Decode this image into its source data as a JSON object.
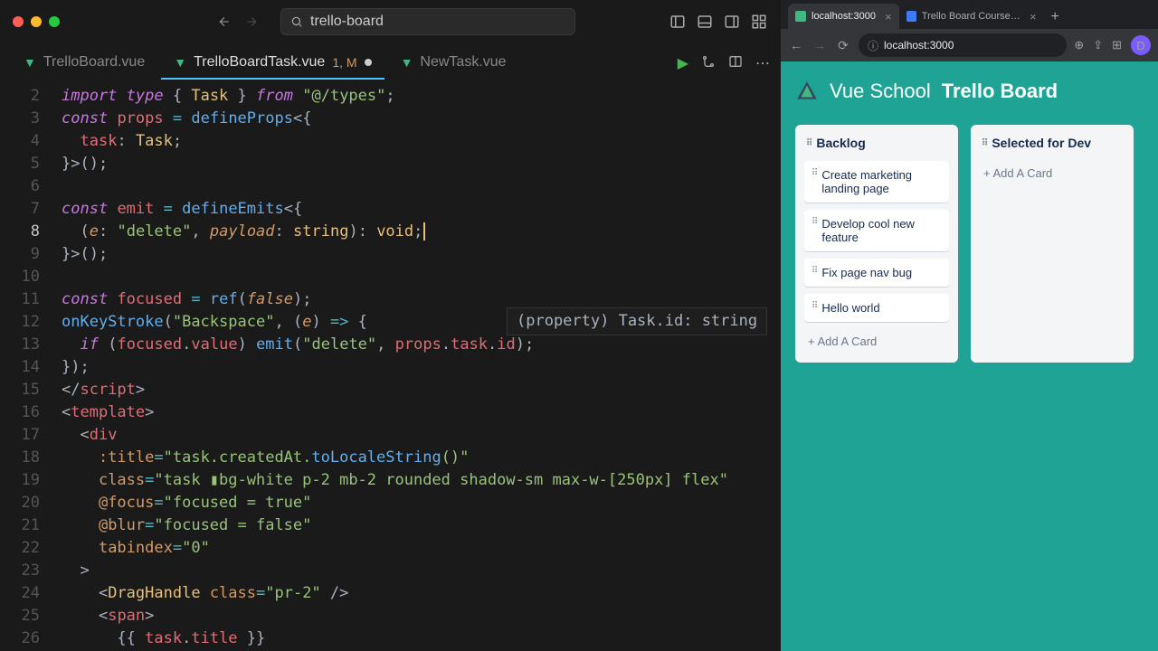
{
  "titlebar": {
    "search_text": "trello-board"
  },
  "tabs": [
    {
      "label": "TrelloBoard.vue",
      "status": "",
      "active": false
    },
    {
      "label": "TrelloBoardTask.vue",
      "status": "1, M",
      "active": true,
      "modified": true
    },
    {
      "label": "NewTask.vue",
      "status": "",
      "active": false
    }
  ],
  "hover_tip": "(property) Task.id: string",
  "gutter": {
    "start": 2,
    "end": 26,
    "active": 8
  },
  "code_lines": [
    {
      "n": 2,
      "html": "<span class='c-kw'>import type</span> <span class='c-punc'>{</span> <span class='c-type'>Task</span> <span class='c-punc'>}</span> <span class='c-kw'>from</span> <span class='c-str'>\"@/types\"</span><span class='c-punc'>;</span>"
    },
    {
      "n": 3,
      "html": "<span class='c-kw'>const</span> <span class='c-var'>props</span> <span class='c-op'>=</span> <span class='c-fn'>defineProps</span><span class='c-punc'>&lt;{</span>"
    },
    {
      "n": 4,
      "html": "  <span class='c-var'>task</span><span class='c-punc'>:</span> <span class='c-type'>Task</span><span class='c-punc'>;</span>"
    },
    {
      "n": 5,
      "html": "<span class='c-punc'>}&gt;();</span>"
    },
    {
      "n": 6,
      "html": ""
    },
    {
      "n": 7,
      "html": "<span class='c-kw'>const</span> <span class='c-var'>emit</span> <span class='c-op'>=</span> <span class='c-fn'>defineEmits</span><span class='c-punc'>&lt;{</span>"
    },
    {
      "n": 8,
      "html": "  <span class='c-punc'>(</span><span class='c-param'>e</span><span class='c-punc'>:</span> <span class='c-str'>\"delete\"</span><span class='c-punc'>,</span> <span class='c-param'>payload</span><span class='c-punc'>:</span> <span class='c-type'>string</span><span class='c-punc'>):</span> <span class='c-type'>void</span><span class='c-punc'>;</span><span class='cursor'></span>"
    },
    {
      "n": 9,
      "html": "<span class='c-punc'>}&gt;();</span>"
    },
    {
      "n": 10,
      "html": ""
    },
    {
      "n": 11,
      "html": "<span class='c-kw'>const</span> <span class='c-var'>focused</span> <span class='c-op'>=</span> <span class='c-fn'>ref</span><span class='c-punc'>(</span><span class='c-param'>false</span><span class='c-punc'>);</span>"
    },
    {
      "n": 12,
      "html": "<span class='c-fn'>onKeyStroke</span><span class='c-punc'>(</span><span class='c-str'>\"Backspace\"</span><span class='c-punc'>,</span> <span class='c-punc'>(</span><span class='c-param'>e</span><span class='c-punc'>)</span> <span class='c-op'>=&gt;</span> <span class='c-punc'>{</span>"
    },
    {
      "n": 13,
      "html": "  <span class='c-kw'>if</span> <span class='c-punc'>(</span><span class='c-var'>focused</span><span class='c-punc'>.</span><span class='c-var'>value</span><span class='c-punc'>)</span> <span class='c-fn'>emit</span><span class='c-punc'>(</span><span class='c-str'>\"delete\"</span><span class='c-punc'>,</span> <span class='c-var'>props</span><span class='c-punc'>.</span><span class='c-var'>task</span><span class='c-punc'>.</span><span class='c-var'>id</span><span class='c-punc'>);</span>"
    },
    {
      "n": 14,
      "html": "<span class='c-punc'>});</span>"
    },
    {
      "n": 15,
      "html": "<span class='c-punc'>&lt;/</span><span class='c-tag'>script</span><span class='c-punc'>&gt;</span>"
    },
    {
      "n": 16,
      "html": "<span class='c-punc'>&lt;</span><span class='c-tag'>template</span><span class='c-punc'>&gt;</span>"
    },
    {
      "n": 17,
      "html": "  <span class='c-punc'>&lt;</span><span class='c-tag'>div</span>"
    },
    {
      "n": 18,
      "html": "    <span class='c-attr'>:title</span><span class='c-op'>=</span><span class='c-str'>\"task.createdAt.</span><span class='c-fn'>toLocaleString</span><span class='c-str'>()\"</span>"
    },
    {
      "n": 19,
      "html": "    <span class='c-attr'>class</span><span class='c-op'>=</span><span class='c-str'>\"task ▮bg-white p-2 mb-2 rounded shadow-sm max-w-[250px] flex\"</span>"
    },
    {
      "n": 20,
      "html": "    <span class='c-attr'>@focus</span><span class='c-op'>=</span><span class='c-str'>\"focused = true\"</span>"
    },
    {
      "n": 21,
      "html": "    <span class='c-attr'>@blur</span><span class='c-op'>=</span><span class='c-str'>\"focused = false\"</span>"
    },
    {
      "n": 22,
      "html": "    <span class='c-attr'>tabindex</span><span class='c-op'>=</span><span class='c-str'>\"0\"</span>"
    },
    {
      "n": 23,
      "html": "  <span class='c-punc'>&gt;</span>"
    },
    {
      "n": 24,
      "html": "    <span class='c-punc'>&lt;</span><span class='c-type'>DragHandle</span> <span class='c-attr'>class</span><span class='c-op'>=</span><span class='c-str'>\"pr-2\"</span> <span class='c-punc'>/&gt;</span>"
    },
    {
      "n": 25,
      "html": "    <span class='c-punc'>&lt;</span><span class='c-tag'>span</span><span class='c-punc'>&gt;</span>"
    },
    {
      "n": 26,
      "html": "      <span class='c-punc'>{{</span> <span class='c-var'>task</span><span class='c-punc'>.</span><span class='c-var'>title</span> <span class='c-punc'>}}</span>"
    }
  ],
  "browser": {
    "tabs": [
      {
        "label": "localhost:3000",
        "active": true
      },
      {
        "label": "Trello Board Course | Tr",
        "active": false
      }
    ],
    "url": "localhost:3000",
    "avatar_letter": "D"
  },
  "app": {
    "brand1": "Vue School",
    "brand2": "Trello Board",
    "columns": [
      {
        "title": "Backlog",
        "cards": [
          "Create marketing landing page",
          "Develop cool new feature",
          "Fix page nav bug",
          "Hello world"
        ],
        "add_label": "+ Add A Card"
      },
      {
        "title": "Selected for Dev",
        "cards": [],
        "add_label": "+ Add A Card"
      }
    ]
  }
}
